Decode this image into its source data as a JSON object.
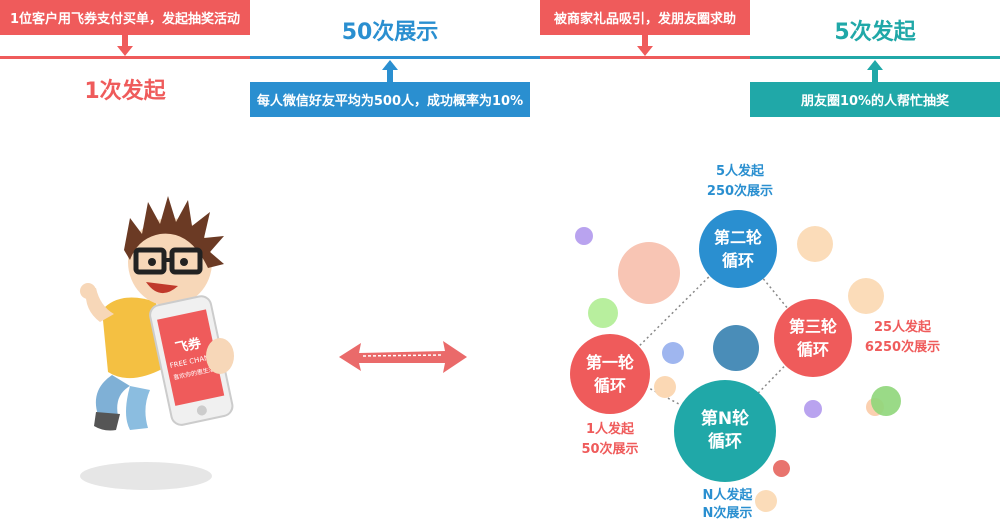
{
  "top": {
    "box1": "1位客户用飞券支付买单，发起抽奖活动",
    "big1": "1次发起",
    "big2": "50次展示",
    "box2": "每人微信好友平均为500人，成功概率为10%",
    "box3": "被商家礼品吸引，发朋友圈求助",
    "big4": "5次发起",
    "box4": "朋友圈10%的人帮忙抽奖"
  },
  "phone": {
    "brand": "飞券",
    "brand_en": "FREE CHANGE",
    "slogan": "喜欢你的惠生活"
  },
  "cycle": {
    "loop1": "第一轮\n循环",
    "loop2": "第二轮\n循环",
    "loop3": "第三轮\n循环",
    "loopN": "第N轮\n循环",
    "cap1a": "1人发起",
    "cap1b": "50次展示",
    "cap2a": "5人发起",
    "cap2b": "250次展示",
    "cap3a": "25人发起",
    "cap3b": "6250次展示",
    "capNa": "N人发起",
    "capNb": "N次展示"
  },
  "colors": {
    "red": "#ef5b5b",
    "blue": "#2a8fd0",
    "teal": "#20a8a8"
  }
}
